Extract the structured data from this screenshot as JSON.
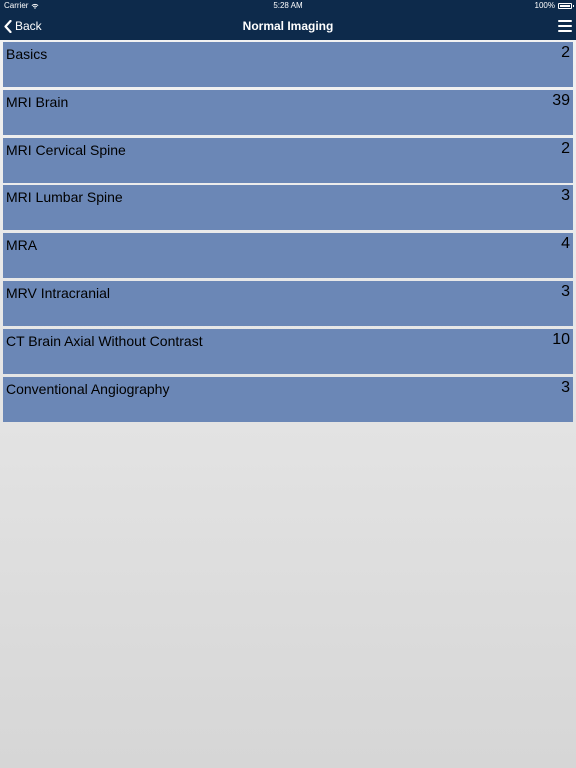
{
  "status_bar": {
    "carrier": "Carrier",
    "time": "5:28 AM",
    "battery": "100%",
    "wifi_icon": "wifi-icon",
    "battery_icon": "battery-icon"
  },
  "nav": {
    "back_label": "Back",
    "back_icon": "chevron-left-icon",
    "title": "Normal Imaging",
    "menu_icon": "hamburger-menu-icon"
  },
  "colors": {
    "nav_background": "#0d2a4b",
    "list_item_background": "#6b87b6",
    "page_background": "#e6e6e6"
  },
  "list": {
    "items": [
      {
        "label": "Basics",
        "count": "2"
      },
      {
        "label": "MRI Brain",
        "count": "39"
      },
      {
        "label": "MRI Cervical Spine",
        "count": "2"
      },
      {
        "label": "MRI Lumbar Spine",
        "count": "3"
      },
      {
        "label": "MRA",
        "count": "4"
      },
      {
        "label": "MRV Intracranial",
        "count": "3"
      },
      {
        "label": "CT Brain Axial Without Contrast",
        "count": "10"
      },
      {
        "label": "Conventional Angiography",
        "count": "3"
      }
    ]
  }
}
